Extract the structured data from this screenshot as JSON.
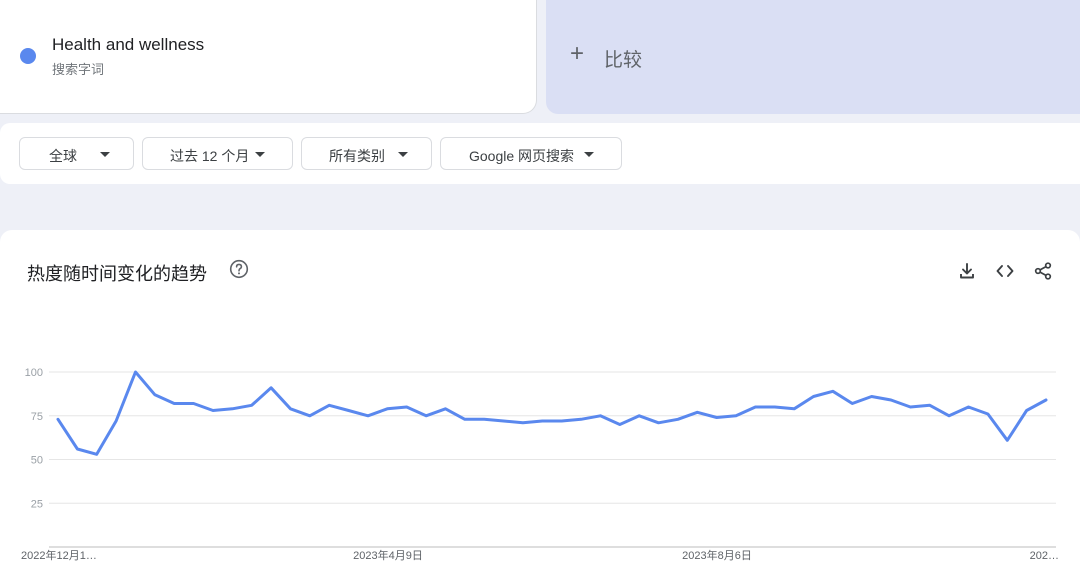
{
  "term": {
    "name": "Health and wellness",
    "subtitle": "搜索字词",
    "color": "#5a88ee"
  },
  "compare": {
    "label": "比较",
    "icon": "plus-icon"
  },
  "filters": [
    {
      "label": "全球"
    },
    {
      "label": "过去 12 个月"
    },
    {
      "label": "所有类别"
    },
    {
      "label": "Google 网页搜索"
    }
  ],
  "chart_section": {
    "title": "热度随时间变化的趋势",
    "icons": [
      "help-icon",
      "download-icon",
      "embed-code-icon",
      "share-icon"
    ]
  },
  "chart_data": {
    "type": "line",
    "title": "",
    "xlabel": "",
    "ylabel": "",
    "ylim": [
      0,
      100
    ],
    "yticks": [
      25,
      50,
      75,
      100
    ],
    "grid": true,
    "x_tick_labels": [
      "2022年12月1…",
      "2023年4月9日",
      "2023年8月6日",
      "202…"
    ],
    "series": [
      {
        "color": "#5a88ee",
        "values": [
          73,
          56,
          53,
          72,
          100,
          87,
          82,
          82,
          78,
          79,
          81,
          91,
          79,
          75,
          81,
          78,
          75,
          79,
          80,
          75,
          79,
          73,
          73,
          72,
          71,
          72,
          72,
          73,
          75,
          70,
          75,
          71,
          73,
          77,
          74,
          75,
          80,
          80,
          79,
          86,
          89,
          82,
          86,
          84,
          80,
          81,
          75,
          80,
          76,
          61,
          78,
          84
        ]
      }
    ]
  }
}
